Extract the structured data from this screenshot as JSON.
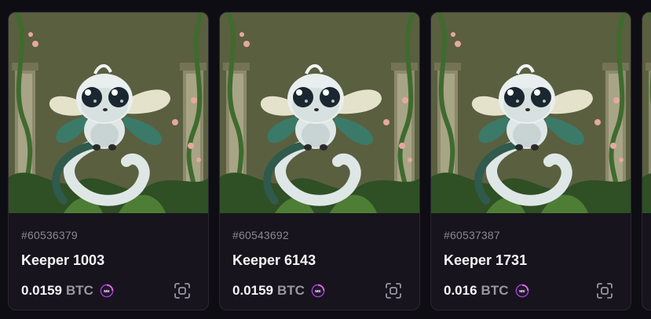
{
  "items": [
    {
      "id": "#60536379",
      "name": "Keeper 1003",
      "price": "0.0159",
      "currency": "BTC",
      "sky_color": "#86a63a",
      "chain_icon": "magic-eden-icon",
      "action_icon": "scan-icon"
    },
    {
      "id": "#60543692",
      "name": "Keeper 6143",
      "price": "0.0159",
      "currency": "BTC",
      "sky_color": "#0b0b8a",
      "chain_icon": "magic-eden-icon",
      "action_icon": "scan-icon"
    },
    {
      "id": "#60537387",
      "name": "Keeper 1731",
      "price": "0.016",
      "currency": "BTC",
      "sky_color": "#5d8fbd",
      "chain_icon": "magic-eden-icon",
      "action_icon": "scan-icon"
    }
  ],
  "colors": {
    "page_background": "#0f0d14",
    "card_background": "#17141d",
    "accent": "#a33fd6"
  }
}
